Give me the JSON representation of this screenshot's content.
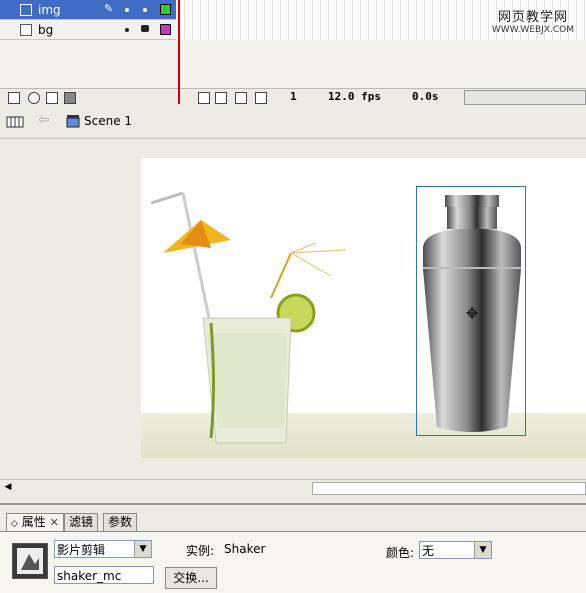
{
  "timeline": {
    "layers": [
      {
        "name": "img",
        "selected": true,
        "color": "#33cc33"
      },
      {
        "name": "bg",
        "selected": false,
        "color": "#cc33cc"
      }
    ],
    "current_frame": "1",
    "fps": "12.0 fps",
    "time": "0.0s"
  },
  "watermark": {
    "line1": "网页教学网",
    "line2": "WWW.WEBJX.COM"
  },
  "editbar": {
    "scene_label": "Scene 1"
  },
  "properties": {
    "tabs": [
      "属性",
      "滤镜",
      "参数"
    ],
    "symbol_type": "影片剪辑",
    "instance_label": "实例:",
    "instance_value": "Shaker",
    "instance_name": "shaker_mc",
    "color_label": "颜色:",
    "color_value": "无",
    "swap_button": "交换..."
  },
  "colors": {
    "selected_layer": "#3f6cc4",
    "playhead": "#cc0000",
    "selection_box": "#2f6fcf"
  }
}
